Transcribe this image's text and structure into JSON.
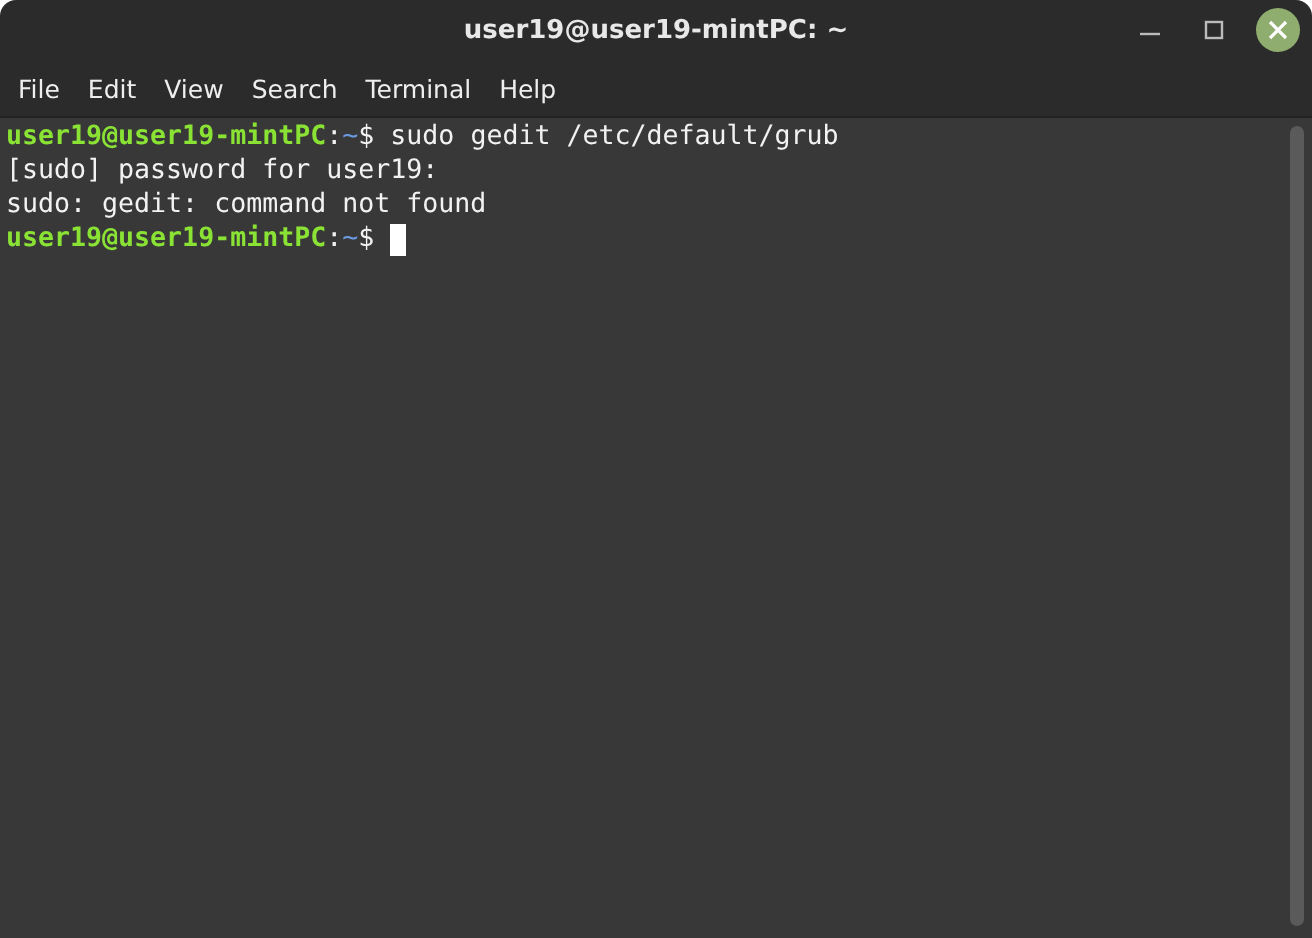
{
  "window": {
    "title": "user19@user19-mintPC: ~"
  },
  "menu": [
    "File",
    "Edit",
    "View",
    "Search",
    "Terminal",
    "Help"
  ],
  "lines": [
    {
      "kind": "prompt",
      "user": "user19@user19-mintPC",
      "separator": ":",
      "path": "~",
      "symbol": "$",
      "command": " sudo gedit /etc/default/grub",
      "cursor": false
    },
    {
      "kind": "output",
      "text": "[sudo] password for user19:"
    },
    {
      "kind": "output",
      "text": "sudo: gedit: command not found"
    },
    {
      "kind": "prompt",
      "user": "user19@user19-mintPC",
      "separator": ":",
      "path": "~",
      "symbol": "$",
      "cursor": true
    }
  ]
}
